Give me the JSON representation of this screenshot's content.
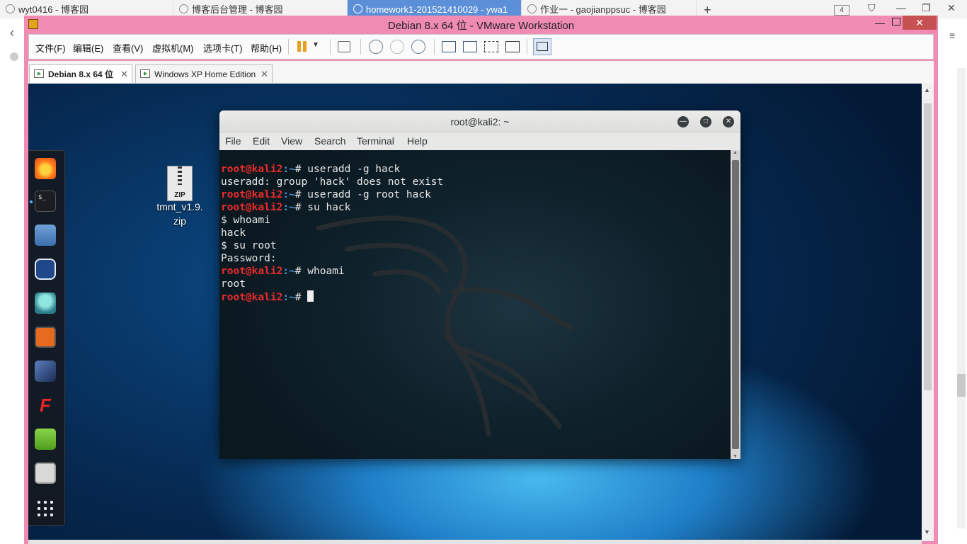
{
  "browser": {
    "tabs": [
      {
        "label": "wyt0416 - 博客园"
      },
      {
        "label": "博客后台管理 - 博客园"
      },
      {
        "label": "homework1-201521410029 - ywa1"
      },
      {
        "label": "作业一 - gaojianppsuc - 博客园"
      }
    ],
    "new_tab": "+",
    "tab_count": "4"
  },
  "vmware": {
    "title": "Debian 8.x 64 位 - VMware Workstation",
    "menus": [
      "文件(F)",
      "编辑(E)",
      "查看(V)",
      "虚拟机(M)",
      "选项卡(T)",
      "帮助(H)"
    ],
    "tabs": [
      {
        "label": "Debian 8.x 64 位"
      },
      {
        "label": "Windows XP Home Edition"
      }
    ],
    "close_symbol": "✕"
  },
  "desktop": {
    "file_name": "tmnt_v1.9.zip",
    "file_name_line1": "tmnt_v1.9.",
    "file_name_line2": "zip",
    "zip_badge": "ZIP",
    "dock_icons": [
      "firefox-icon",
      "terminal-icon",
      "files-icon",
      "metasploit-icon",
      "armitage-icon",
      "burpsuite-icon",
      "beef-icon",
      "faraday-icon",
      "leafpad-icon",
      "cherrytree-icon"
    ]
  },
  "terminal": {
    "title": "root@kali2: ~",
    "menus": [
      "File",
      "Edit",
      "View",
      "Search",
      "Terminal",
      "Help"
    ],
    "lines": [
      {
        "prompt_user": "root@kali2",
        "prompt_path": ":~",
        "prompt_sym": "# ",
        "text": "useradd -g hack"
      },
      {
        "text": "useradd: group 'hack' does not exist"
      },
      {
        "prompt_user": "root@kali2",
        "prompt_path": ":~",
        "prompt_sym": "# ",
        "text": "useradd -g root hack"
      },
      {
        "prompt_user": "root@kali2",
        "prompt_path": ":~",
        "prompt_sym": "# ",
        "text": "su hack"
      },
      {
        "text": "$ whoami"
      },
      {
        "text": "hack"
      },
      {
        "text": "$ su root"
      },
      {
        "text": "Password:"
      },
      {
        "prompt_user": "root@kali2",
        "prompt_path": ":~",
        "prompt_sym": "# ",
        "text": "whoami"
      },
      {
        "text": "root"
      },
      {
        "prompt_user": "root@kali2",
        "prompt_path": ":~",
        "prompt_sym": "# ",
        "text": "",
        "cursor": true
      }
    ]
  },
  "colors": {
    "vmware_frame": "#f08cb4",
    "prompt_user": "#ee2b2b",
    "prompt_path": "#4e8fd6",
    "terminal_bg": "#0c1e26"
  }
}
